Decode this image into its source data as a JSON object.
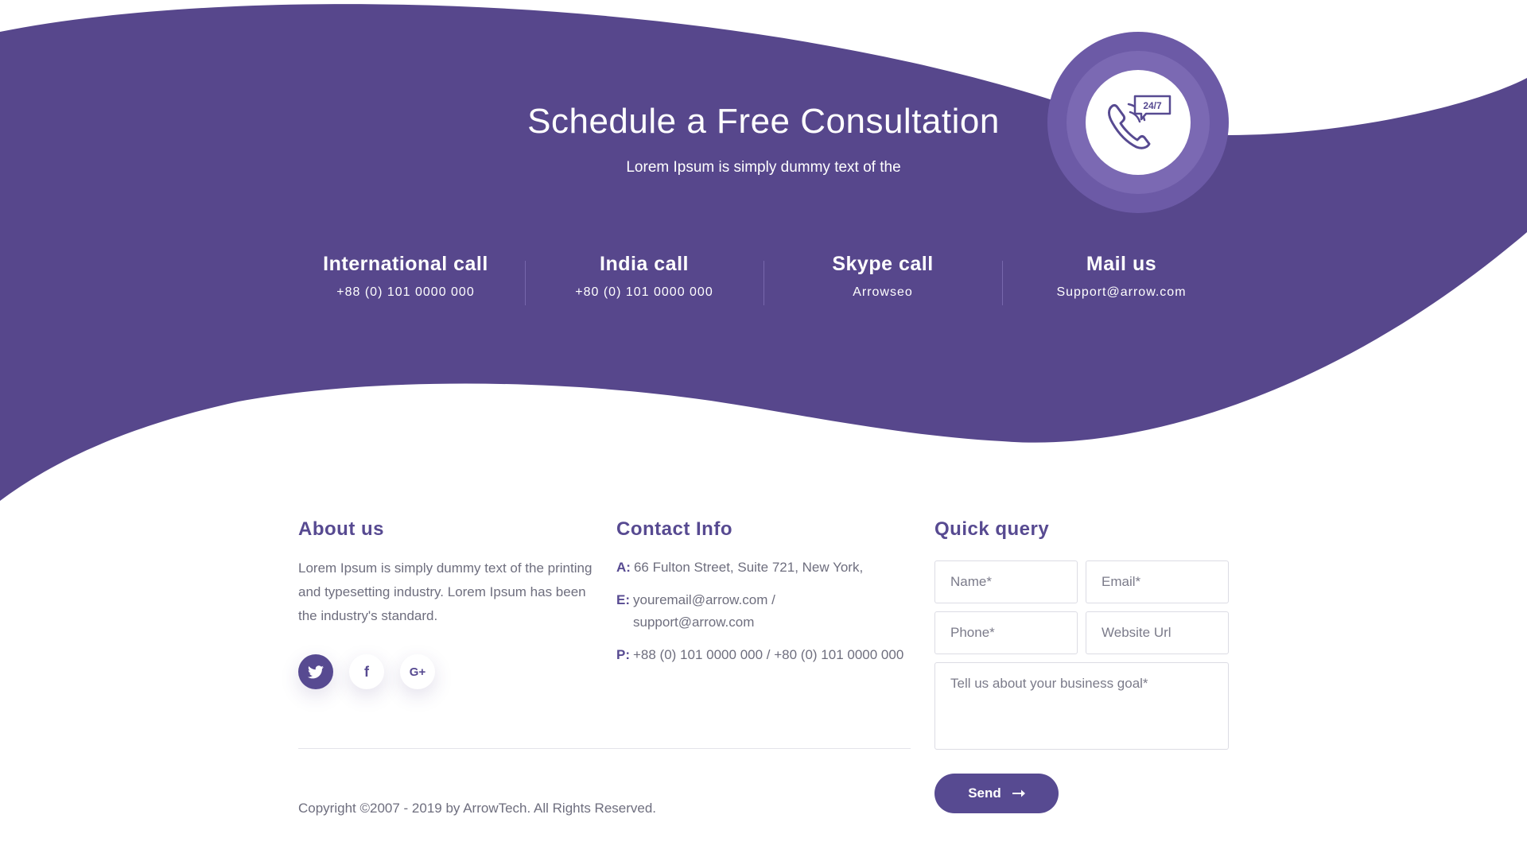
{
  "colors": {
    "primary": "#574a91",
    "hero_bg": "#57478c",
    "ring_outer": "#6c5aa6",
    "ring_inner": "#7b69b3",
    "text_muted": "#6e6e7e"
  },
  "hero": {
    "title": "Schedule a Free Consultation",
    "subtitle": "Lorem Ipsum is simply dummy text of the",
    "support_icon": "phone-24-7-icon",
    "support_label": "24/7"
  },
  "calls": [
    {
      "title": "International call",
      "value": "+88 (0) 101 0000 000"
    },
    {
      "title": "India call",
      "value": "+80 (0) 101 0000 000"
    },
    {
      "title": "Skype call",
      "value": "Arrowseo"
    },
    {
      "title": "Mail us",
      "value": "Support@arrow.com"
    }
  ],
  "about": {
    "title": "About us",
    "text": "Lorem Ipsum is simply dummy text of the printing and typesetting industry. Lorem Ipsum has been the industry's standard.",
    "socials": [
      {
        "icon": "twitter-icon",
        "glyph": "t"
      },
      {
        "icon": "facebook-icon",
        "glyph": "f"
      },
      {
        "icon": "google-plus-icon",
        "glyph": "G+"
      }
    ]
  },
  "contact": {
    "title": "Contact Info",
    "address_label": "A:",
    "address": "66 Fulton Street, Suite 721, New York,",
    "email_label": "E:",
    "email": "youremail@arrow.com / support@arrow.com",
    "phone_label": "P:",
    "phone": "+88 (0) 101 0000 000 / +80 (0) 101 0000 000"
  },
  "query": {
    "title": "Quick query",
    "name_placeholder": "Name*",
    "email_placeholder": "Email*",
    "phone_placeholder": "Phone*",
    "website_placeholder": "Website Url",
    "goal_placeholder": "Tell us about your business goal*",
    "send_label": "Send",
    "send_icon": "arrow-right-icon"
  },
  "footer": {
    "copyright": "Copyright ©2007 - 2019 by ArrowTech. All Rights Reserved."
  }
}
